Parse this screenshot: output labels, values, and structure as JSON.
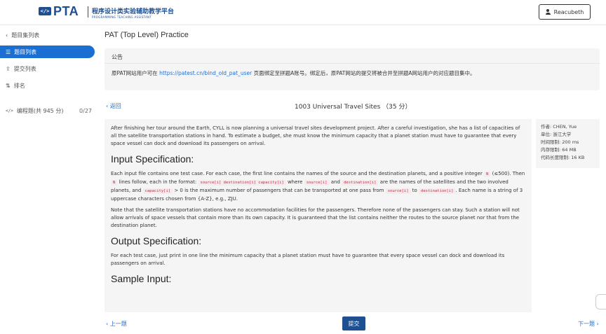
{
  "header": {
    "logo_icon": "</>",
    "logo_text": "PTA",
    "subtitle_cn": "程序设计类实验辅助教学平台",
    "subtitle_en": "PROGRAMMING TEACHING ASSISTANT",
    "user": "Reacubeth"
  },
  "sidebar": {
    "back_label": "题目集列表",
    "items": [
      {
        "label": "题目列表",
        "icon": "list-icon",
        "active": true
      },
      {
        "label": "提交列表",
        "icon": "upload-icon"
      },
      {
        "label": "排名",
        "icon": "sort-icon"
      }
    ],
    "category": {
      "label": "编程题(共 945 分)",
      "count": "0/27"
    }
  },
  "main": {
    "page_title": "PAT (Top Level) Practice",
    "notice": {
      "heading": "公告",
      "text_before": "原PAT网站用户可在 ",
      "link": "https://patest.cn/bind_old_pat_user",
      "text_after": " 页面绑定至拼题A账号。绑定后，原PAT网站的提交将被合并至拼题A网站用户的对应题目集中。"
    },
    "back": "返回",
    "problem_title": "1003 Universal Travel Sites （35 分）",
    "paragraphs": {
      "intro": "After finishing her tour around the Earth, CYLL is now planning a universal travel sites development project. After a careful investigation, she has a list of capacities of all the satellite transportation stations in hand. To estimate a budget, she must know the minimum capacity that a planet station must have to guarantee that every space vessel can dock and download its passengers on arrival.",
      "input_heading": "Input Specification:",
      "input_p1_a": "Each input file contains one test case. For each case, the first line contains the names of the source and the destination planets, and a positive integer ",
      "input_p1_b": " (≤500). Then ",
      "input_p1_c": " lines follow, each in the format: ",
      "input_p1_d": " where ",
      "input_p1_e": " and ",
      "input_p1_f": " are the names of the satellites and the two involved planets, and ",
      "input_p1_g": " > 0 is the maximum number of passengers that can be transported at one pass from ",
      "input_p1_h": " to ",
      "input_p1_i": ". Each name is a string of 3 uppercase characters chosen from {A-Z}, e.g., ZJU.",
      "code_n": "N",
      "code_format": "source[i] destination[i] capacity[i]",
      "code_source": "source[i]",
      "code_dest": "destination[i]",
      "code_cap": "capacity[i]",
      "input_p2": "Note that the satellite transportation stations have no accommodation facilities for the passengers. Therefore none of the passengers can stay. Such a station will not allow arrivals of space vessels that contain more than its own capacity. It is guaranteed that the list contains neither the routes to the source planet nor that from the destination planet.",
      "output_heading": "Output Specification:",
      "output_p": "For each test case, just print in one line the minimum capacity that a planet station must have to guarantee that every space vessel can dock and download its passengers on arrival.",
      "sample_heading": "Sample Input:"
    },
    "meta": [
      "作者: CHEN, Yue",
      "单位: 浙江大学",
      "时间限制: 200 ms",
      "内存限制: 64 MB",
      "代码长度限制: 16 KB"
    ],
    "prev": "上一题",
    "submit": "提交",
    "next": "下一题"
  }
}
